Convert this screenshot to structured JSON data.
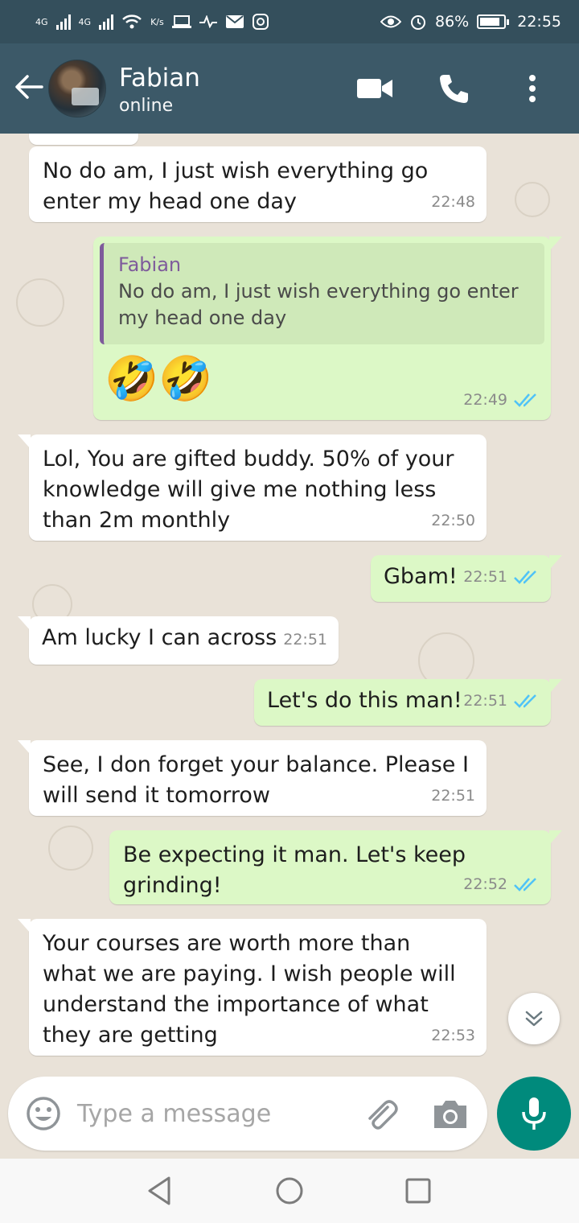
{
  "status_bar": {
    "network1": "4G",
    "network2": "4G",
    "speed_unit": "K/s",
    "battery_percent": "86%",
    "battery_level": 0.86,
    "time": "22:55"
  },
  "header": {
    "contact_name": "Fabian",
    "contact_status": "online"
  },
  "messages": [
    {
      "direction": "in",
      "text": "No do am, I just wish everything go enter my head one day",
      "time": "22:48"
    },
    {
      "direction": "out",
      "quote_name": "Fabian",
      "quote_text": "No do am, I just wish everything go enter my head one day",
      "text": "🤣🤣",
      "time": "22:49",
      "read": true
    },
    {
      "direction": "in",
      "text": "Lol, You are gifted buddy. 50% of your knowledge will give me nothing less than 2m monthly",
      "time": "22:50"
    },
    {
      "direction": "out",
      "text": "Gbam!",
      "time": "22:51",
      "read": true
    },
    {
      "direction": "in",
      "text": "Am lucky I can across",
      "time": "22:51"
    },
    {
      "direction": "out",
      "text": "Let's do this man!",
      "time": "22:51",
      "read": true
    },
    {
      "direction": "in",
      "text": "See, I don forget your balance. Please I will send it tomorrow",
      "time": "22:51"
    },
    {
      "direction": "out",
      "text": "Be expecting it man. Let's keep grinding!",
      "time": "22:52",
      "read": true
    },
    {
      "direction": "in",
      "text": "Your courses are worth more than what we are paying. I wish people will understand the importance of what they are getting",
      "time": "22:53"
    }
  ],
  "composer": {
    "placeholder": "Type a message"
  },
  "colors": {
    "header": "#3c5968",
    "statusbar": "#344f5c",
    "outgoing_bubble": "#dcf8c6",
    "incoming_bubble": "#ffffff",
    "accent": "#008a7c",
    "read_ticks": "#4fc3f7"
  },
  "icons": {
    "back": "arrow-left-icon",
    "video": "video-call-icon",
    "call": "phone-icon",
    "menu": "more-vert-icon",
    "emoji": "emoji-icon",
    "attach": "paperclip-icon",
    "camera": "camera-icon",
    "mic": "microphone-icon",
    "scroll_down": "chevron-double-down-icon"
  }
}
